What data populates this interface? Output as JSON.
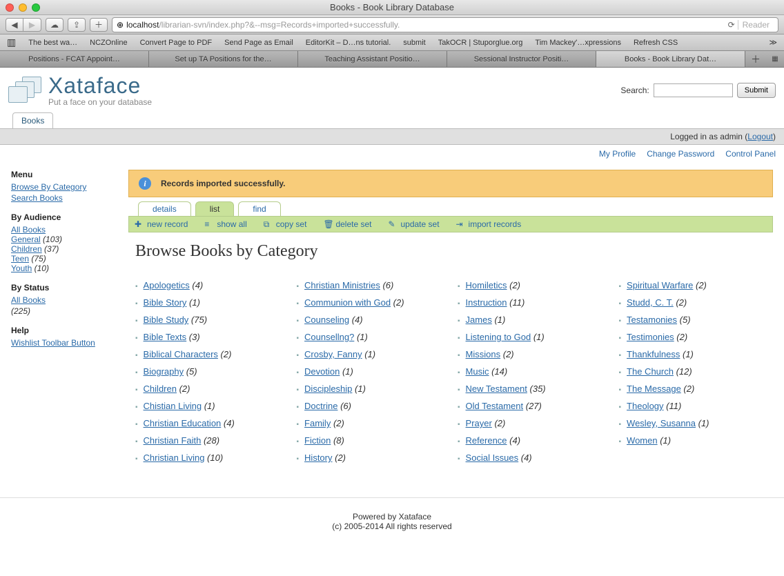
{
  "window": {
    "title": "Books - Book Library Database"
  },
  "address": {
    "host": "localhost",
    "path": "/librarian-svn/index.php?&--msg=Records+imported+successfully.",
    "reader": "Reader"
  },
  "bookmarks": [
    "The best wa…",
    "NCZOnline",
    "Convert Page to PDF",
    "Send Page as Email",
    "EditorKit – D…ns tutorial.",
    "submit",
    "TakOCR | Stuporglue.org",
    "Tim Mackey'…xpressions",
    "Refresh CSS"
  ],
  "tabs": [
    {
      "label": "Positions - FCAT Appoint…"
    },
    {
      "label": "Set up TA Positions for the…"
    },
    {
      "label": "Teaching Assistant Positio…"
    },
    {
      "label": "Sessional Instructor Positi…"
    },
    {
      "label": "Books - Book Library Dat…",
      "active": true
    }
  ],
  "logo": {
    "name": "Xataface",
    "tagline": "Put a face on your database"
  },
  "search": {
    "label": "Search:",
    "submit": "Submit"
  },
  "maintab": "Books",
  "status": {
    "text": "Logged in as admin (",
    "link": "Logout",
    "after": ")"
  },
  "userlinks": [
    "My Profile",
    "Change Password",
    "Control Panel"
  ],
  "message": "Records imported successfully.",
  "viewtabs": {
    "details": "details",
    "list": "list",
    "find": "find"
  },
  "actions": {
    "new": "new record",
    "showall": "show all",
    "copy": "copy set",
    "delete": "delete set",
    "update": "update set",
    "import": "import records"
  },
  "pagetitle": "Browse Books by Category",
  "sidebar": {
    "menu_h": "Menu",
    "browse": "Browse By Category",
    "searchbooks": "Search Books",
    "audience_h": "By Audience",
    "audience": [
      {
        "label": "All Books",
        "count": ""
      },
      {
        "label": "General",
        "count": "(103)"
      },
      {
        "label": "Children",
        "count": "(37)"
      },
      {
        "label": "Teen",
        "count": "(75)"
      },
      {
        "label": "Youth",
        "count": "(10)"
      }
    ],
    "status_h": "By Status",
    "status_all": "All Books",
    "status_count": "(225)",
    "help_h": "Help",
    "wishlist": "Wishlist Toolbar Button"
  },
  "categories": [
    [
      {
        "name": "Apologetics",
        "count": "(4)"
      },
      {
        "name": "Bible Story",
        "count": "(1)"
      },
      {
        "name": "Bible Study",
        "count": "(75)"
      },
      {
        "name": "Bible Texts",
        "count": "(3)"
      },
      {
        "name": "Biblical Characters",
        "count": "(2)"
      },
      {
        "name": "Biography",
        "count": "(5)"
      },
      {
        "name": "Children",
        "count": "(2)"
      },
      {
        "name": "Chistian Living",
        "count": "(1)"
      },
      {
        "name": "Christian Education",
        "count": "(4)"
      },
      {
        "name": "Christian Faith",
        "count": "(28)"
      },
      {
        "name": "Christian Living",
        "count": "(10)"
      }
    ],
    [
      {
        "name": "Christian Ministries",
        "count": "(6)"
      },
      {
        "name": "Communion with God",
        "count": "(2)"
      },
      {
        "name": "Counseling",
        "count": "(4)"
      },
      {
        "name": "Counsellng?",
        "count": "(1)"
      },
      {
        "name": "Crosby, Fanny",
        "count": "(1)"
      },
      {
        "name": "Devotion",
        "count": "(1)"
      },
      {
        "name": "Discipleship",
        "count": "(1)"
      },
      {
        "name": "Doctrine",
        "count": "(6)"
      },
      {
        "name": "Family",
        "count": "(2)"
      },
      {
        "name": "Fiction",
        "count": "(8)"
      },
      {
        "name": "History",
        "count": "(2)"
      }
    ],
    [
      {
        "name": "Homiletics",
        "count": "(2)"
      },
      {
        "name": "Instruction",
        "count": "(11)"
      },
      {
        "name": "James",
        "count": "(1)"
      },
      {
        "name": "Listening to God",
        "count": "(1)"
      },
      {
        "name": "Missions",
        "count": "(2)"
      },
      {
        "name": "Music",
        "count": "(14)"
      },
      {
        "name": "New Testament",
        "count": "(35)"
      },
      {
        "name": "Old Testament",
        "count": "(27)"
      },
      {
        "name": "Prayer",
        "count": "(2)"
      },
      {
        "name": "Reference",
        "count": "(4)"
      },
      {
        "name": "Social Issues",
        "count": "(4)"
      }
    ],
    [
      {
        "name": "Spiritual Warfare",
        "count": "(2)"
      },
      {
        "name": "Studd, C. T.",
        "count": "(2)"
      },
      {
        "name": "Testamonies",
        "count": "(5)"
      },
      {
        "name": "Testimonies",
        "count": "(2)"
      },
      {
        "name": "Thankfulness",
        "count": "(1)"
      },
      {
        "name": "The Church",
        "count": "(12)"
      },
      {
        "name": "The Message",
        "count": "(2)"
      },
      {
        "name": "Theology",
        "count": "(11)"
      },
      {
        "name": "Wesley, Susanna",
        "count": "(1)"
      },
      {
        "name": "Women",
        "count": "(1)"
      }
    ]
  ],
  "footer": {
    "line1": "Powered by Xataface",
    "line2": "(c) 2005-2014 All rights reserved"
  }
}
